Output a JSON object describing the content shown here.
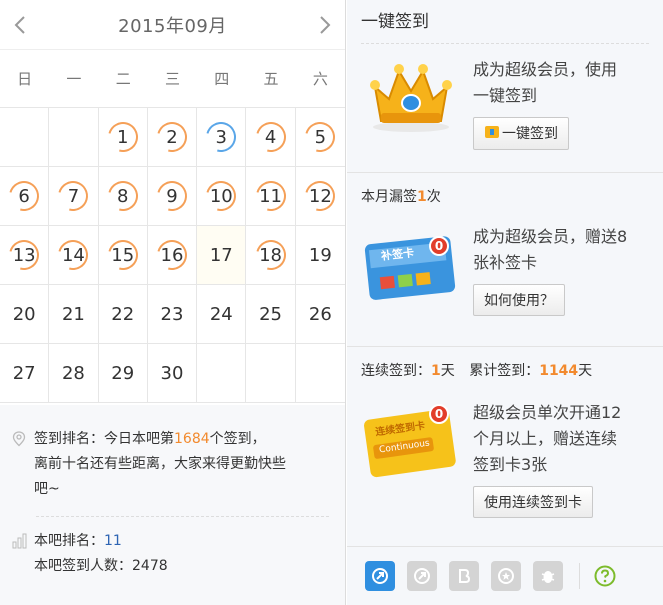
{
  "calendar": {
    "title": "2015年09月",
    "prev_icon": "chevron-left-icon",
    "next_icon": "chevron-right-icon",
    "weekdays": [
      "日",
      "一",
      "二",
      "三",
      "四",
      "五",
      "六"
    ],
    "rows": [
      [
        {
          "d": ""
        },
        {
          "d": ""
        },
        {
          "d": "1",
          "s": "signed"
        },
        {
          "d": "2",
          "s": "signed"
        },
        {
          "d": "3",
          "s": "blue"
        },
        {
          "d": "4",
          "s": "signed"
        },
        {
          "d": "5",
          "s": "signed"
        }
      ],
      [
        {
          "d": "6",
          "s": "signed"
        },
        {
          "d": "7",
          "s": "signed"
        },
        {
          "d": "8",
          "s": "signed"
        },
        {
          "d": "9",
          "s": "signed"
        },
        {
          "d": "10",
          "s": "signed"
        },
        {
          "d": "11",
          "s": "signed"
        },
        {
          "d": "12",
          "s": "signed"
        }
      ],
      [
        {
          "d": "13",
          "s": "signed"
        },
        {
          "d": "14",
          "s": "signed"
        },
        {
          "d": "15",
          "s": "signed"
        },
        {
          "d": "16",
          "s": "signed"
        },
        {
          "d": "17",
          "s": "today"
        },
        {
          "d": "18",
          "s": "signed"
        },
        {
          "d": "19"
        }
      ],
      [
        {
          "d": "20"
        },
        {
          "d": "21"
        },
        {
          "d": "22"
        },
        {
          "d": "23"
        },
        {
          "d": "24"
        },
        {
          "d": "25"
        },
        {
          "d": "26"
        }
      ],
      [
        {
          "d": "27"
        },
        {
          "d": "28"
        },
        {
          "d": "29"
        },
        {
          "d": "30"
        },
        {
          "d": ""
        },
        {
          "d": ""
        },
        {
          "d": ""
        }
      ]
    ]
  },
  "ranking": {
    "line1_prefix": "签到排名：今日本吧第",
    "line1_rank": "1684",
    "line1_suffix": "个签到，",
    "line2": "离前十名还有些距离，大家来得更勤快些",
    "line3": "吧~"
  },
  "stats": {
    "bar_rank_label": "本吧排名：",
    "bar_rank_value": "11",
    "signin_count_label": "本吧签到人数：",
    "signin_count_value": "2478"
  },
  "onekey": {
    "title": "一键签到",
    "promo_line1": "成为超级会员，使用",
    "promo_line2": "一键签到",
    "button": "一键签到"
  },
  "makeup": {
    "missed_prefix": "本月漏签",
    "missed_count": "1",
    "missed_suffix": "次",
    "card_badge": "0",
    "card_label": "补签卡",
    "promo_line1": "成为超级会员，赠送8",
    "promo_line2": "张补签卡",
    "button": "如何使用？"
  },
  "continuous": {
    "streak_label": "连续签到：",
    "streak_value": "1",
    "streak_unit": "天",
    "total_label": "累计签到：",
    "total_value": "1144",
    "total_unit": "天",
    "card_badge": "0",
    "card_label": "连续签到卡",
    "card_sub": "Continuous",
    "promo_line1": "超级会员单次开通12",
    "promo_line2": "个月以上，赠送连续",
    "promo_line3": "签到卡3张",
    "button": "使用连续签到卡"
  },
  "colors": {
    "accent_orange": "#f28a2e",
    "ring_orange": "#f5a058",
    "ring_blue": "#5aa6e8",
    "link_blue": "#2d64b3",
    "help_green": "#7cbb2b"
  },
  "bottom_icons": [
    "badge-arrow-icon",
    "badge-arrow-gray-icon",
    "badge-b-icon",
    "badge-star-icon",
    "badge-bug-icon",
    "help-icon"
  ]
}
